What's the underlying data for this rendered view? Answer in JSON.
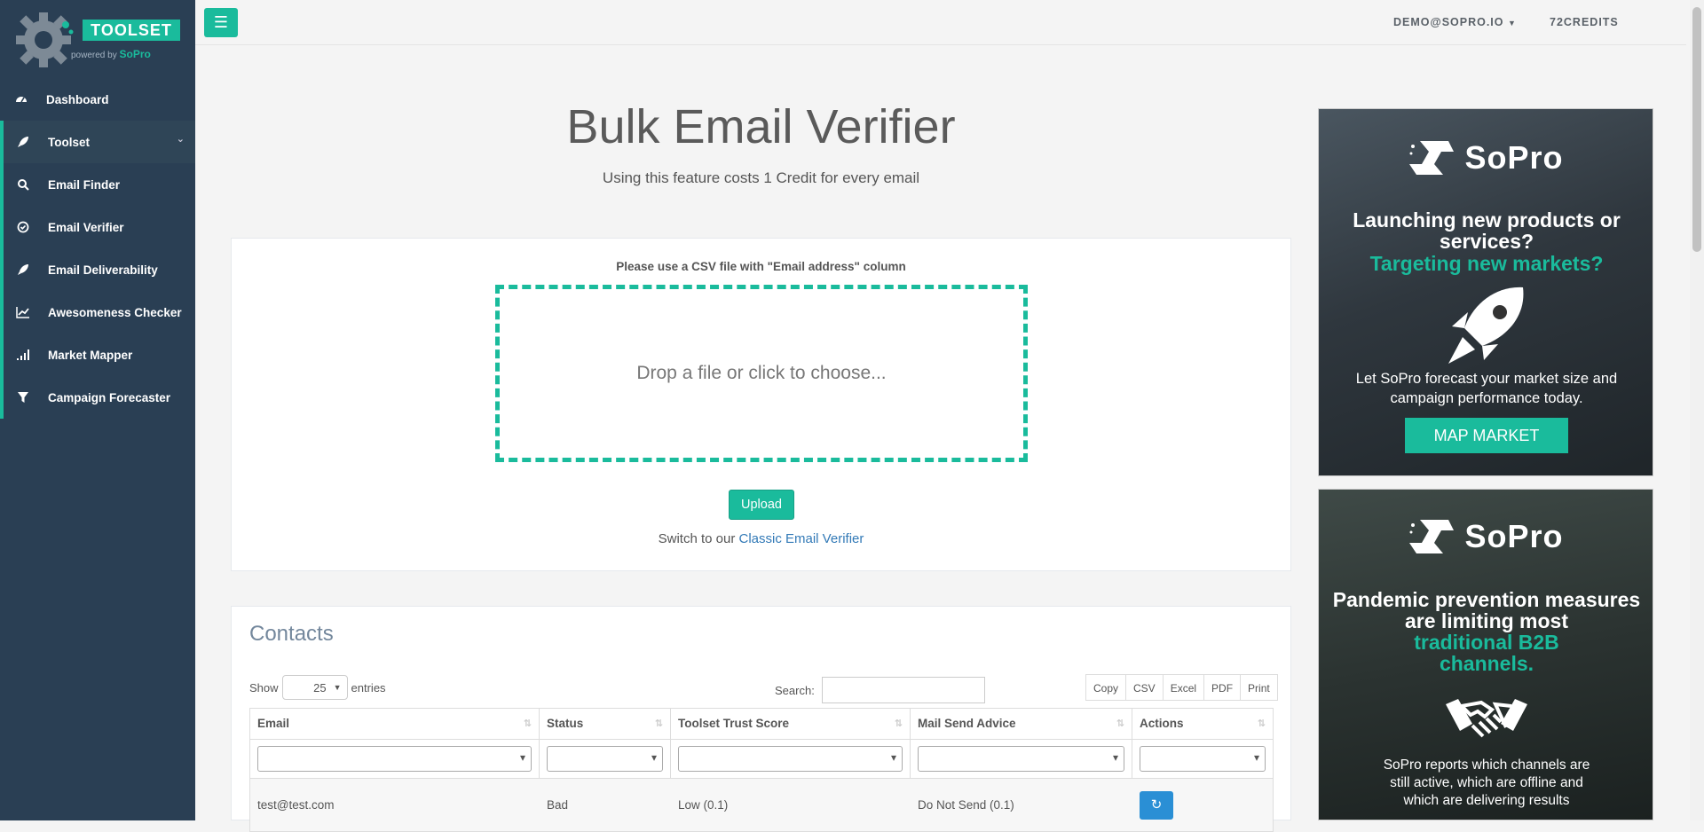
{
  "logo": {
    "badge": "TOOLSET",
    "powered_prefix": "powered by",
    "powered_brand": "SoPro"
  },
  "sidebar": {
    "items": [
      {
        "label": "Dashboard",
        "icon": "dashboard-icon"
      },
      {
        "label": "Toolset",
        "icon": "rocket-icon"
      },
      {
        "label": "Email Finder",
        "icon": "search-icon"
      },
      {
        "label": "Email Verifier",
        "icon": "check-circle-icon"
      },
      {
        "label": "Email Deliverability",
        "icon": "rocket-icon"
      },
      {
        "label": "Awesomeness Checker",
        "icon": "line-chart-icon"
      },
      {
        "label": "Market Mapper",
        "icon": "signal-icon"
      },
      {
        "label": "Campaign Forecaster",
        "icon": "filter-icon"
      }
    ]
  },
  "topbar": {
    "user": "DEMO@SOPRO.IO",
    "credits": "72CREDITS"
  },
  "page": {
    "title": "Bulk Email Verifier",
    "subtitle": "Using this feature costs 1 Credit for every email",
    "csv_note": "Please use a CSV file with \"Email address\" column",
    "dropzone": "Drop a file or click to choose...",
    "upload": "Upload",
    "switch_prefix": "Switch to our",
    "switch_link": "Classic Email Verifier"
  },
  "contacts": {
    "title": "Contacts",
    "show_label": "Show",
    "entries_value": "25",
    "entries_label": "entries",
    "search_label": "Search:",
    "exports": [
      "Copy",
      "CSV",
      "Excel",
      "PDF",
      "Print"
    ],
    "columns": [
      "Email",
      "Status",
      "Toolset Trust Score",
      "Mail Send Advice",
      "Actions"
    ],
    "rows": [
      {
        "email": "test@test.com",
        "status": "Bad",
        "score": "Low (0.1)",
        "advice": "Do Not Send (0.1)"
      }
    ]
  },
  "ads": [
    {
      "brand": "SoPro",
      "headline1": "Launching new products or services?",
      "headline2": "Targeting new markets?",
      "body": "Let SoPro forecast your market size and campaign performance today.",
      "cta": "MAP MARKET"
    },
    {
      "brand": "SoPro",
      "headline1": "Pandemic prevention measures are limiting most",
      "headline2": "traditional B2B channels.",
      "body": "SoPro reports which channels are still active, which are offline and which are delivering results"
    }
  ],
  "colors": {
    "accent": "#1abb9c",
    "sidebar": "#2a3f54",
    "action_blue": "#2a8fd5"
  }
}
